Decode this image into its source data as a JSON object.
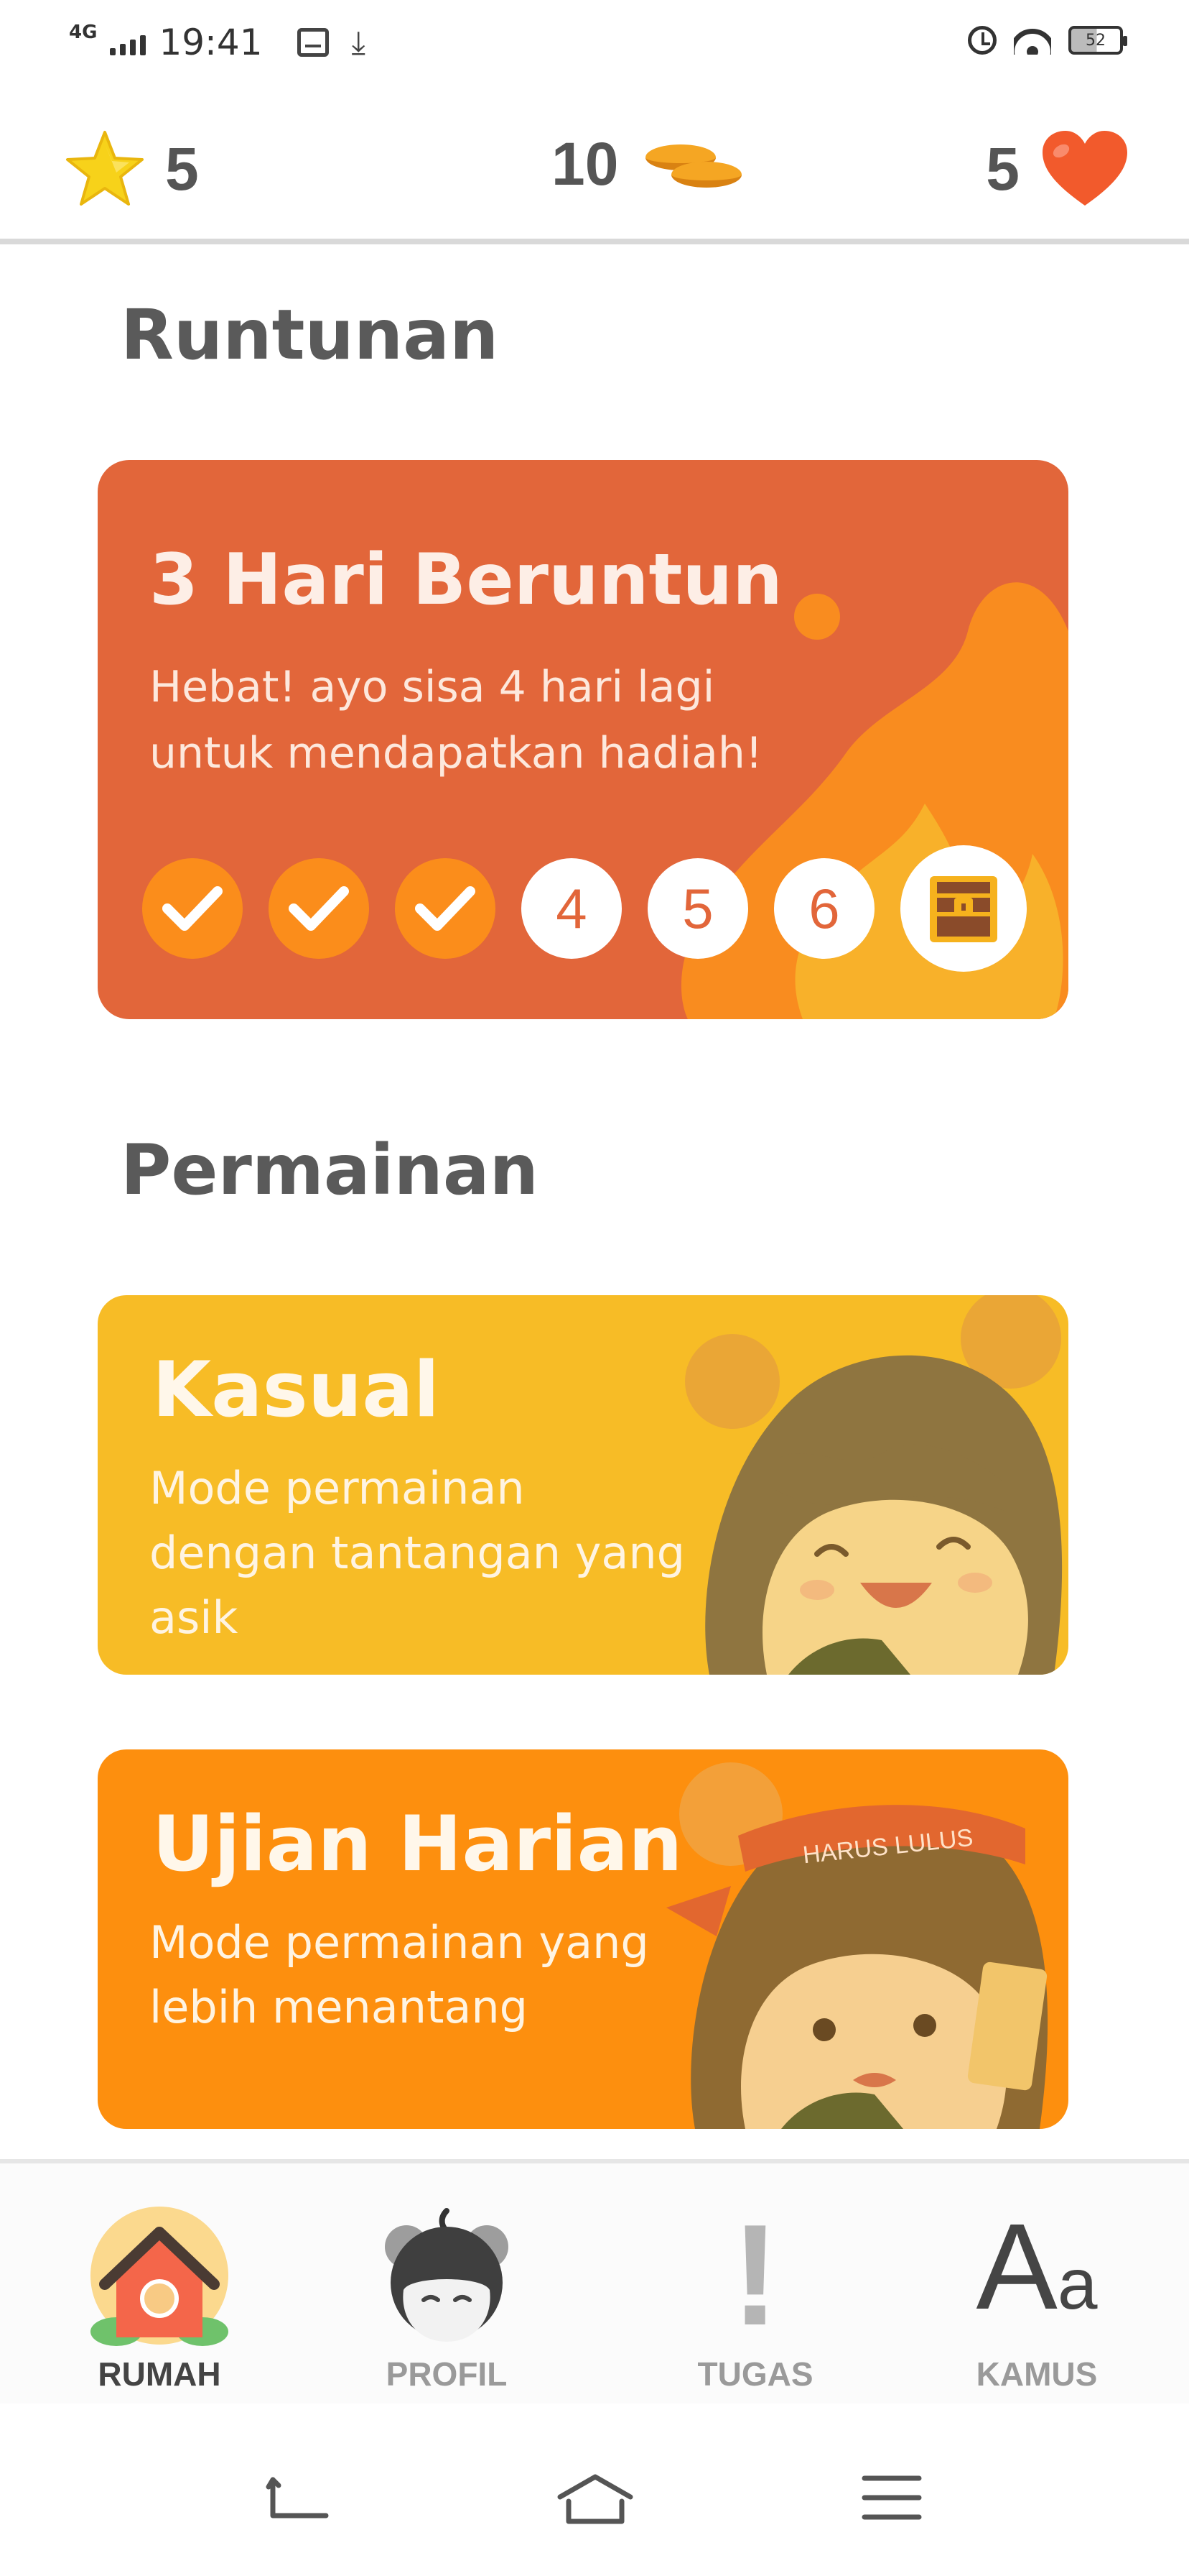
{
  "status_bar": {
    "network": "4G",
    "time": "19:41",
    "battery": "52"
  },
  "stats": {
    "stars": "5",
    "coins": "10",
    "hearts": "5"
  },
  "streak": {
    "section_title": "Runtunan",
    "title": "3 Hari Beruntun",
    "subtitle": "Hebat! ayo sisa 4 hari lagi untuk mendapatkan hadiah!",
    "days": [
      {
        "state": "done",
        "label": ""
      },
      {
        "state": "done",
        "label": ""
      },
      {
        "state": "done",
        "label": ""
      },
      {
        "state": "todo",
        "label": "4"
      },
      {
        "state": "todo",
        "label": "5"
      },
      {
        "state": "todo",
        "label": "6"
      },
      {
        "state": "reward",
        "label": ""
      }
    ]
  },
  "games": {
    "section_title": "Permainan",
    "modes": [
      {
        "title": "Kasual",
        "description": "Mode permainan dengan tantangan yang asik"
      },
      {
        "title": "Ujian Harian",
        "description": "Mode permainan yang lebih menantang",
        "headband_text": "HARUS LULUS"
      }
    ]
  },
  "nav": {
    "items": [
      {
        "label": "RUMAH",
        "icon": "house-icon",
        "active": true
      },
      {
        "label": "PROFIL",
        "icon": "avatar-icon",
        "active": false
      },
      {
        "label": "TUGAS",
        "icon": "exclamation-icon",
        "active": false
      },
      {
        "label": "KAMUS",
        "icon": "dictionary-icon",
        "active": false,
        "glyph": "A",
        "glyph_small": "a"
      }
    ]
  },
  "colors": {
    "streak_card": "#e2663a",
    "casual_card": "#f7bc26",
    "daily_card": "#fd8f0e",
    "check_circle": "#fb8d1b",
    "heart": "#f25a2c",
    "star": "#f7d21a"
  }
}
